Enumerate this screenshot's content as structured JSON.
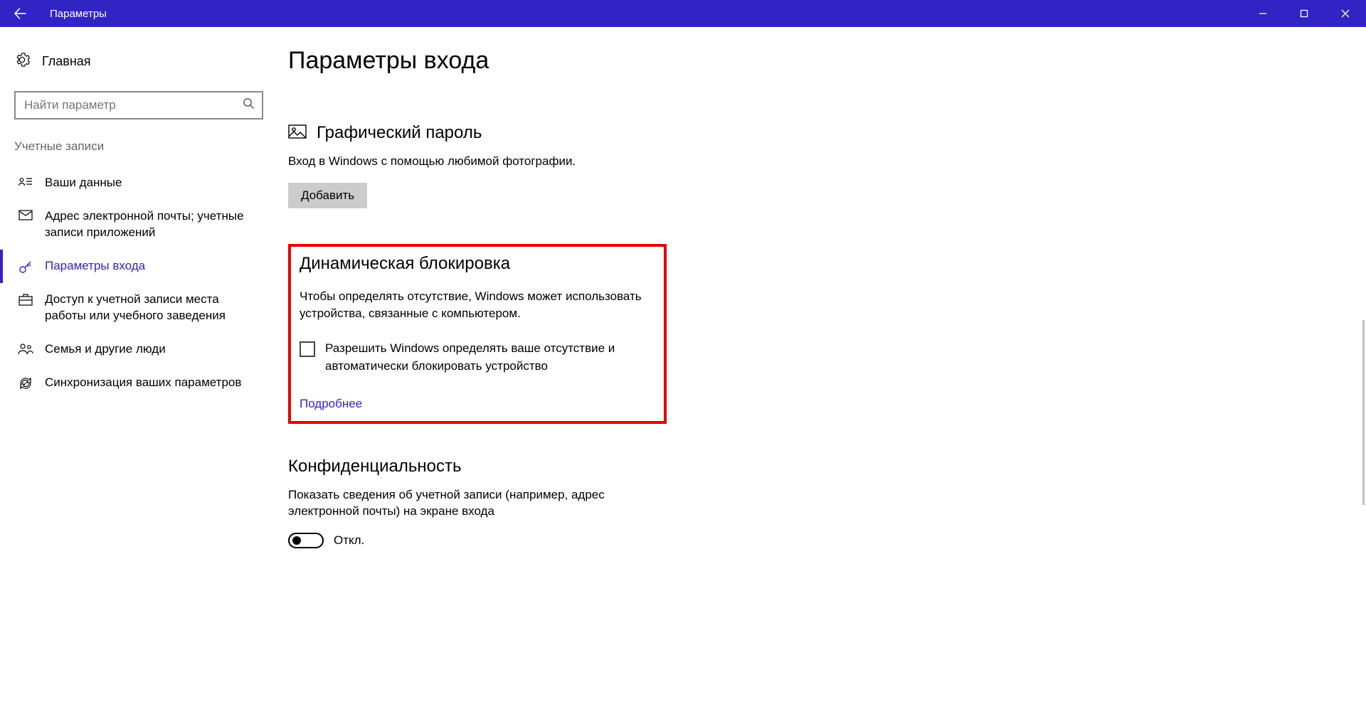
{
  "titlebar": {
    "title": "Параметры"
  },
  "sidebar": {
    "home_label": "Главная",
    "search_placeholder": "Найти параметр",
    "section_label": "Учетные записи",
    "items": [
      {
        "label": "Ваши данные"
      },
      {
        "label": "Адрес электронной почты; учетные записи приложений"
      },
      {
        "label": "Параметры входа"
      },
      {
        "label": "Доступ к учетной записи места работы или учебного заведения"
      },
      {
        "label": "Семья и другие люди"
      },
      {
        "label": "Синхронизация ваших параметров"
      }
    ]
  },
  "main": {
    "page_title": "Параметры входа",
    "picture_password": {
      "heading": "Графический пароль",
      "desc": "Вход в Windows с помощью любимой фотографии.",
      "button": "Добавить"
    },
    "dynamic_lock": {
      "heading": "Динамическая блокировка",
      "desc": "Чтобы определять отсутствие, Windows может использовать устройства, связанные с компьютером.",
      "checkbox_label": "Разрешить Windows определять ваше отсутствие и автоматически блокировать устройство",
      "more_link": "Подробнее"
    },
    "privacy": {
      "heading": "Конфиденциальность",
      "desc": "Показать сведения об учетной записи (например, адрес электронной почты) на экране входа",
      "toggle_state": "Откл."
    }
  }
}
